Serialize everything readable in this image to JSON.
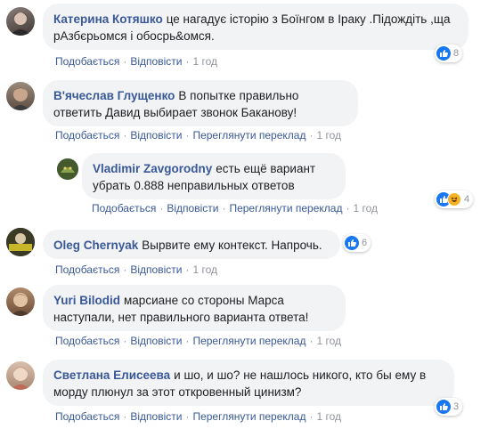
{
  "actions": {
    "like": "Подобається",
    "reply": "Відповісти",
    "translate": "Переглянути переклад",
    "sep": "·"
  },
  "comments": [
    {
      "author": "Катерина Котяшко",
      "text": "це нагадує історію з Боїнгом в Іраку .Підождіть ,ща рАзбєрьомся і обосрь&омся.",
      "time": "1 год",
      "reactions": "8",
      "reaction_icons": [
        "like-icon"
      ]
    },
    {
      "author": "В'ячеслав Глущенко",
      "text": "В попытке правильно ответить Давид выбирает звонок Баканову!",
      "time": "1 год"
    },
    {
      "author": "Vladimir Zavgorodny",
      "text": "есть ещё вариант убрать 0.888 неправильных ответов",
      "time": "1 год",
      "reactions": "4",
      "reaction_icons": [
        "like-icon",
        "haha-icon"
      ]
    },
    {
      "author": "Oleg Chernyak",
      "text": "Вырвите ему контекст. Напрочь.",
      "time": "1 год",
      "reactions": "6",
      "reaction_icons": [
        "like-icon"
      ]
    },
    {
      "author": "Yuri Bilodid",
      "text": "марсиане со стороны Марса наступали, нет правильного варианта ответа!",
      "time": "1 год"
    },
    {
      "author": "Светлана Елисеева",
      "text": "и шо, и шо? не нашлось никого, кто бы ему в морду плюнул за этот откровенный цинизм?",
      "time": "1 год",
      "reactions": "3",
      "reaction_icons": [
        "like-icon"
      ]
    }
  ]
}
